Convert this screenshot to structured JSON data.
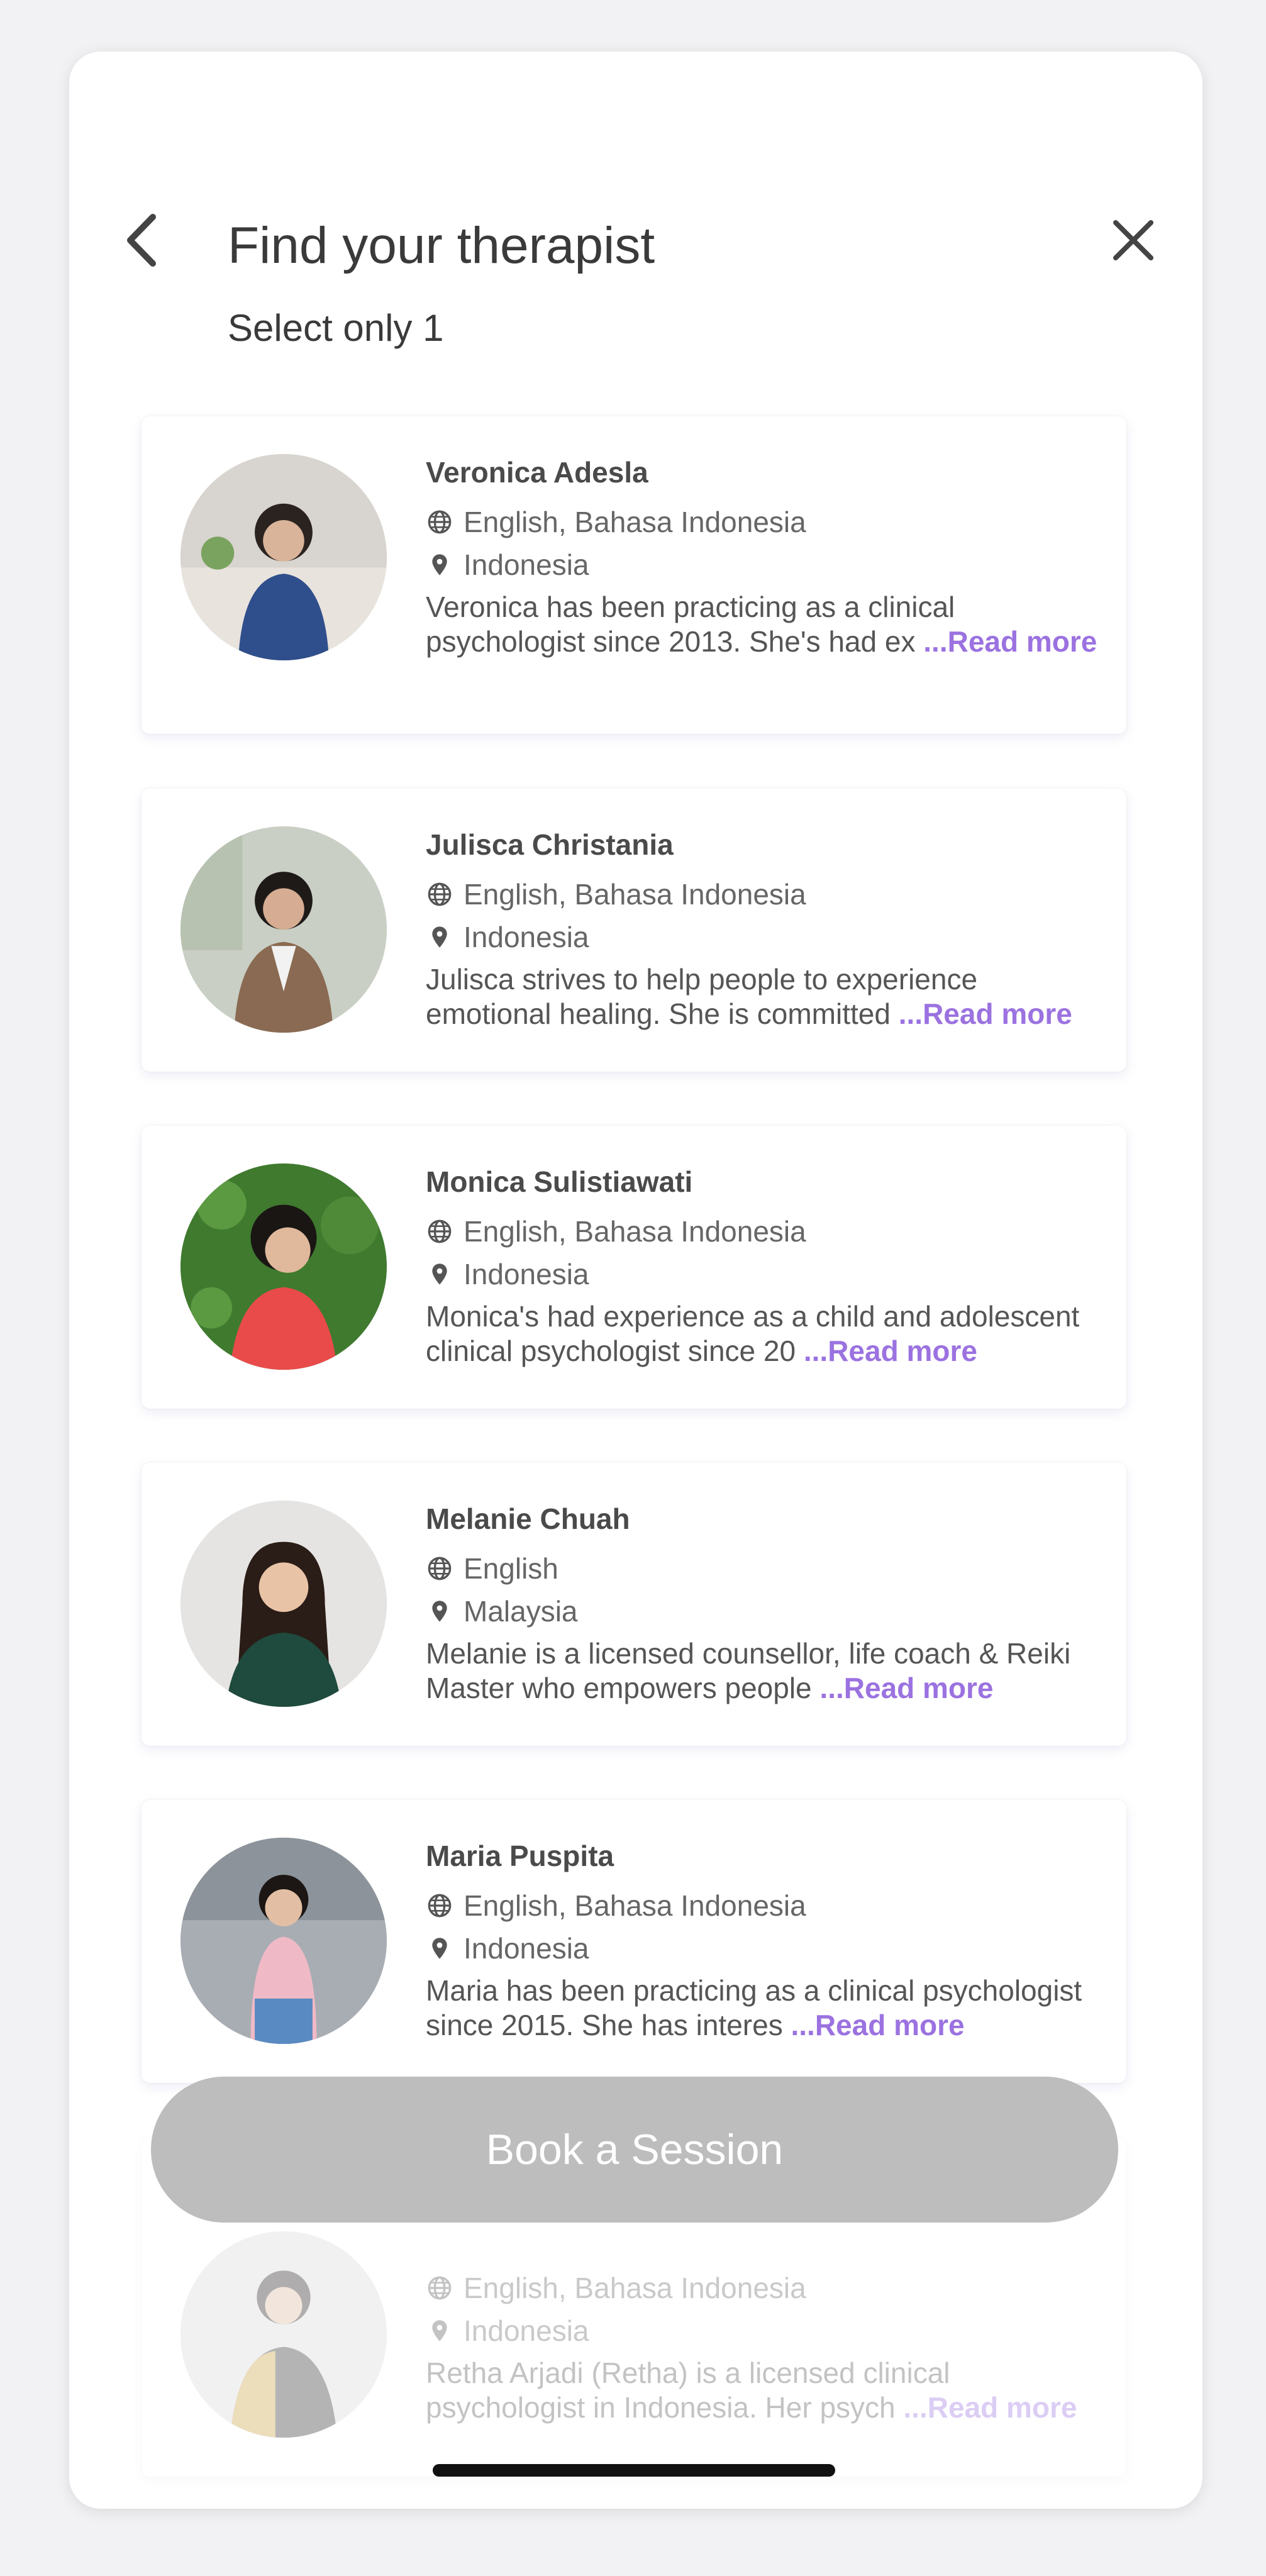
{
  "header": {
    "title": "Find your therapist",
    "subtitle": "Select only 1"
  },
  "icons": {
    "back": "chevron-left-icon",
    "close": "close-icon",
    "language": "globe-icon",
    "location": "map-pin-icon"
  },
  "colors": {
    "accent": "#9b72e0",
    "button_disabled": "#bdbdbd",
    "text": "#3a3a3a"
  },
  "therapists": [
    {
      "name": "Veronica Adesla",
      "languages": "English, Bahasa Indonesia",
      "location": "Indonesia",
      "description": "Veronica has been practicing as a clinical psychologist since 2013. She's had ex ",
      "read_more": "...Read more"
    },
    {
      "name": "Julisca Christania",
      "languages": "English, Bahasa Indonesia",
      "location": "Indonesia",
      "description": "Julisca strives to help people to experience emotional healing. She is committed ",
      "read_more": "...Read more"
    },
    {
      "name": "Monica Sulistiawati",
      "languages": "English, Bahasa Indonesia",
      "location": "Indonesia",
      "description": "Monica's had experience as a child and adolescent clinical psychologist since 20 ",
      "read_more": "...Read more"
    },
    {
      "name": "Melanie Chuah",
      "languages": "English",
      "location": "Malaysia",
      "description": "Melanie is a licensed counsellor, life coach & Reiki Master who empowers people  ",
      "read_more": "...Read more"
    },
    {
      "name": "Maria Puspita",
      "languages": "English, Bahasa Indonesia",
      "location": "Indonesia",
      "description": "Maria has been practicing as a clinical psychologist since 2015. She has interes ",
      "read_more": "...Read more"
    },
    {
      "name": "",
      "languages": "English, Bahasa Indonesia",
      "location": "Indonesia",
      "description": "Retha Arjadi (Retha) is a licensed clinical psychologist in Indonesia. Her psych ",
      "read_more": "...Read more"
    }
  ],
  "footer": {
    "book_label": "Book a Session"
  }
}
